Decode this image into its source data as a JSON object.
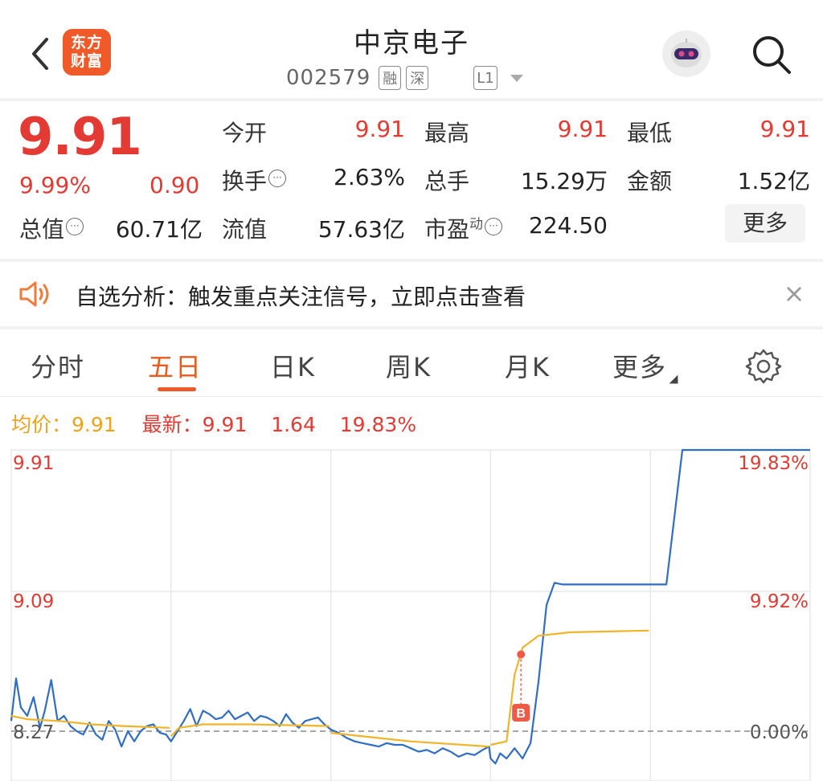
{
  "header": {
    "back_icon": "chevron-left-icon",
    "brand_logo_text_1": "东方",
    "brand_logo_text_2": "财富",
    "stock_name": "中京电子",
    "stock_code": "002579",
    "tags": [
      "融",
      "深",
      "L1"
    ],
    "assistant_icon": "robot-assistant-icon",
    "search_icon": "search-icon"
  },
  "quote": {
    "price": "9.91",
    "change_pct": "9.99%",
    "change_amount": "0.90",
    "rows": [
      [
        {
          "label": "今开",
          "value": "9.91",
          "red": true
        },
        {
          "label": "最高",
          "value": "9.91",
          "red": true
        },
        {
          "label": "最低",
          "value": "9.91",
          "red": true
        }
      ],
      [
        {
          "label": "换手",
          "value": "2.63%",
          "red": false,
          "info": true
        },
        {
          "label": "总手",
          "value": "15.29万",
          "red": false
        },
        {
          "label": "金额",
          "value": "1.52亿",
          "red": false
        }
      ],
      [
        {
          "label": "总值",
          "value": "60.71亿",
          "red": false,
          "info": true
        },
        {
          "label": "流值",
          "value": "57.63亿",
          "red": false
        },
        {
          "label": "市盈",
          "sup": "动",
          "value": "224.50",
          "red": false,
          "info": true
        }
      ]
    ],
    "more_label": "更多"
  },
  "notice": {
    "icon": "speaker-icon",
    "text": "自选分析：触发重点关注信号，立即点击查看",
    "close_icon": "close-icon"
  },
  "tabs": {
    "items": [
      "分时",
      "五日",
      "日K",
      "周K",
      "月K",
      "更多"
    ],
    "active": "五日",
    "settings_icon": "gear-icon"
  },
  "legend": {
    "avg_label": "均价：",
    "avg_value": "9.91",
    "new_label": "最新：",
    "new_value": "9.91",
    "new_change": "1.64",
    "new_pct": "19.83%"
  },
  "chart_data": {
    "type": "line",
    "period": "五日",
    "y_labels_left": [
      "9.91",
      "9.09",
      "8.27"
    ],
    "y_labels_right": [
      "19.83%",
      "9.92%",
      "0.00%"
    ],
    "ylim": [
      8.0,
      9.91
    ],
    "days": 5,
    "baseline": 8.27,
    "marker_label": "B",
    "colors": {
      "price": "#2f6ec4",
      "avg": "#f0b429",
      "axis_red": "#e33b33",
      "grid": "#e8e8e8",
      "baseline": "#888888",
      "marker": "#ee5a4a"
    },
    "series": [
      {
        "key": "price",
        "x": [
          0.0,
          0.03,
          0.06,
          0.1,
          0.14,
          0.18,
          0.21,
          0.25,
          0.29,
          0.33,
          0.37,
          0.41,
          0.45,
          0.49,
          0.53,
          0.57,
          0.61,
          0.65,
          0.69,
          0.73,
          0.77,
          0.81,
          0.85,
          0.89,
          0.93,
          0.97,
          1.0,
          1.04,
          1.08,
          1.12,
          1.16,
          1.2,
          1.24,
          1.28,
          1.32,
          1.36,
          1.4,
          1.44,
          1.48,
          1.52,
          1.56,
          1.6,
          1.64,
          1.68,
          1.72,
          1.76,
          1.8,
          1.84,
          1.88,
          1.92,
          1.96,
          2.0,
          2.05,
          2.1,
          2.15,
          2.2,
          2.25,
          2.3,
          2.35,
          2.4,
          2.45,
          2.5,
          2.55,
          2.6,
          2.65,
          2.7,
          2.75,
          2.8,
          2.85,
          2.9,
          2.95,
          2.99,
          3.0,
          3.03,
          3.06,
          3.1,
          3.15,
          3.2,
          3.25,
          3.3,
          3.35,
          3.4,
          3.45,
          3.5,
          3.55,
          3.6,
          3.65,
          3.7,
          3.75,
          3.8,
          3.85,
          3.9,
          3.95,
          4.0,
          4.05,
          4.1,
          4.2,
          4.4,
          4.6,
          4.8,
          5.0
        ],
        "y": [
          8.33,
          8.58,
          8.41,
          8.36,
          8.47,
          8.29,
          8.39,
          8.57,
          8.33,
          8.36,
          8.3,
          8.27,
          8.25,
          8.32,
          8.25,
          8.22,
          8.33,
          8.28,
          8.18,
          8.27,
          8.21,
          8.27,
          8.3,
          8.31,
          8.26,
          8.25,
          8.21,
          8.27,
          8.33,
          8.4,
          8.3,
          8.39,
          8.37,
          8.34,
          8.35,
          8.39,
          8.34,
          8.36,
          8.38,
          8.33,
          8.36,
          8.35,
          8.33,
          8.3,
          8.37,
          8.32,
          8.29,
          8.33,
          8.34,
          8.35,
          8.31,
          8.28,
          8.26,
          8.23,
          8.21,
          8.2,
          8.19,
          8.18,
          8.2,
          8.19,
          8.19,
          8.17,
          8.15,
          8.16,
          8.14,
          8.17,
          8.15,
          8.12,
          8.14,
          8.13,
          8.16,
          8.18,
          8.11,
          8.08,
          8.14,
          8.11,
          8.17,
          8.11,
          8.2,
          8.56,
          9.01,
          9.14,
          9.13,
          9.13,
          9.13,
          9.13,
          9.13,
          9.13,
          9.13,
          9.13,
          9.13,
          9.13,
          9.13,
          9.13,
          9.13,
          9.13,
          9.91,
          9.91,
          9.91,
          9.91,
          9.91
        ]
      },
      {
        "key": "avg",
        "x": [
          0.0,
          0.1,
          0.3,
          0.5,
          0.7,
          0.99,
          1.0,
          1.05,
          1.2,
          1.5,
          1.99,
          2.0,
          2.5,
          2.99,
          3.0,
          3.1,
          3.15,
          3.2,
          3.3,
          3.5,
          3.99
        ],
        "y": [
          8.36,
          8.34,
          8.33,
          8.31,
          8.3,
          8.29,
          8.24,
          8.29,
          8.31,
          8.31,
          8.3,
          8.26,
          8.21,
          8.18,
          8.19,
          8.21,
          8.6,
          8.76,
          8.83,
          8.85,
          8.86
        ]
      }
    ],
    "marker": {
      "x": 3.19,
      "y": 8.72
    }
  }
}
